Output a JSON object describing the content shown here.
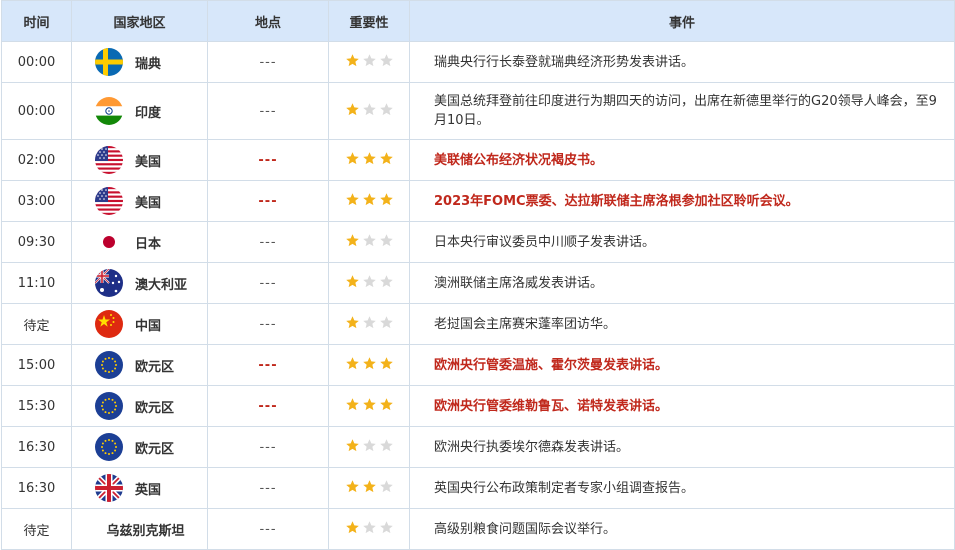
{
  "headers": {
    "time": "时间",
    "country": "国家地区",
    "location": "地点",
    "importance": "重要性",
    "event": "事件"
  },
  "colors": {
    "header_bg": "#d7e7fa",
    "border": "#d2dde8",
    "highlight": "#c0281c",
    "star_on": "#f3b21a",
    "star_off": "#d9d9d9"
  },
  "rows": [
    {
      "time": "00:00",
      "country": "瑞典",
      "flag": "sweden-flag-icon",
      "location": "---",
      "stars": 1,
      "event": "瑞典央行行长泰登就瑞典经济形势发表讲话。",
      "highlight": false
    },
    {
      "time": "00:00",
      "country": "印度",
      "flag": "india-flag-icon",
      "location": "---",
      "stars": 1,
      "event": "美国总统拜登前往印度进行为期四天的访问，出席在新德里举行的G20领导人峰会，至9月10日。",
      "highlight": false
    },
    {
      "time": "02:00",
      "country": "美国",
      "flag": "usa-flag-icon",
      "location": "---",
      "stars": 3,
      "event": "美联储公布经济状况褐皮书。",
      "highlight": true
    },
    {
      "time": "03:00",
      "country": "美国",
      "flag": "usa-flag-icon",
      "location": "---",
      "stars": 3,
      "event": "2023年FOMC票委、达拉斯联储主席洛根参加社区聆听会议。",
      "highlight": true
    },
    {
      "time": "09:30",
      "country": "日本",
      "flag": "japan-flag-icon",
      "location": "---",
      "stars": 1,
      "event": "日本央行审议委员中川顺子发表讲话。",
      "highlight": false
    },
    {
      "time": "11:10",
      "country": "澳大利亚",
      "flag": "australia-flag-icon",
      "location": "---",
      "stars": 1,
      "event": "澳洲联储主席洛威发表讲话。",
      "highlight": false
    },
    {
      "time": "待定",
      "country": "中国",
      "flag": "china-flag-icon",
      "location": "---",
      "stars": 1,
      "event": "老挝国会主席赛宋蓬率团访华。",
      "highlight": false
    },
    {
      "time": "15:00",
      "country": "欧元区",
      "flag": "eu-flag-icon",
      "location": "---",
      "stars": 3,
      "event": "欧洲央行管委温施、霍尔茨曼发表讲话。",
      "highlight": true
    },
    {
      "time": "15:30",
      "country": "欧元区",
      "flag": "eu-flag-icon",
      "location": "---",
      "stars": 3,
      "event": "欧洲央行管委维勒鲁瓦、诺特发表讲话。",
      "highlight": true
    },
    {
      "time": "16:30",
      "country": "欧元区",
      "flag": "eu-flag-icon",
      "location": "---",
      "stars": 1,
      "event": "欧洲央行执委埃尔德森发表讲话。",
      "highlight": false
    },
    {
      "time": "16:30",
      "country": "英国",
      "flag": "uk-flag-icon",
      "location": "---",
      "stars": 2,
      "event": "英国央行公布政策制定者专家小组调查报告。",
      "highlight": false
    },
    {
      "time": "待定",
      "country": "乌兹别克斯坦",
      "flag": "",
      "location": "---",
      "stars": 1,
      "event": "高级别粮食问题国际会议举行。",
      "highlight": false
    }
  ]
}
